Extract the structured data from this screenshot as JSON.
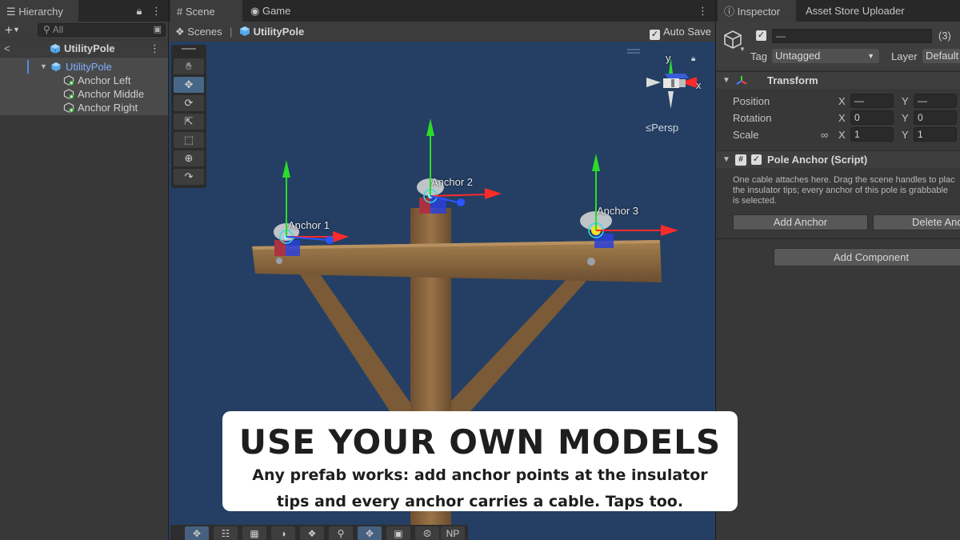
{
  "hierarchy": {
    "tab_label": "Hierarchy",
    "search_placeholder": "All",
    "prefab_title": "UtilityPole",
    "root": "UtilityPole",
    "children": [
      "Anchor Left",
      "Anchor Middle",
      "Anchor Right"
    ]
  },
  "scene": {
    "tabs": [
      "Scene",
      "Game"
    ],
    "breadcrumb_root": "Scenes",
    "breadcrumb_separator": "|",
    "breadcrumb_object": "UtilityPole",
    "auto_save_label": "Auto Save",
    "persp_label": "≤Persp",
    "gizmo_y": "y",
    "gizmo_x": "x",
    "anchor_labels": [
      "Anchor 1",
      "Anchor 2",
      "Anchor 3"
    ],
    "bottom_toolbar_last": "NP"
  },
  "inspector": {
    "tabs": [
      "Inspector",
      "Asset Store Uploader"
    ],
    "name_value": "—",
    "object_count": "(3)",
    "tag_label": "Tag",
    "tag_value": "Untagged",
    "layer_label": "Layer",
    "layer_value": "Default",
    "transform": {
      "title": "Transform",
      "position_label": "Position",
      "rotation_label": "Rotation",
      "scale_label": "Scale",
      "axis_x": "X",
      "axis_y": "Y",
      "position_x": "—",
      "position_y": "—",
      "rotation_x": "0",
      "rotation_y": "0",
      "scale_x": "1",
      "scale_y": "1"
    },
    "pole_anchor": {
      "title": "Pole Anchor (Script)",
      "description_line1": "One cable attaches here. Drag the scene handles to plac",
      "description_line2": "the insulator tips; every anchor of this pole is grabbable",
      "description_line3": "is selected.",
      "add_anchor_label": "Add Anchor",
      "delete_anchor_label": "Delete And"
    },
    "add_component_label": "Add Component"
  },
  "banner": {
    "title": "USE YOUR OWN MODELS",
    "line1": "Any prefab works: add anchor points at the insulator",
    "line2": "tips and every anchor carries a cable. Taps too."
  },
  "colors": {
    "viewport_bg": "#243f63",
    "wood": "#8a6640",
    "axis_x": "#ff2a2a",
    "axis_y": "#2bdc2b",
    "axis_z": "#2a55ff",
    "selection_blue": "#7fb0ff"
  }
}
